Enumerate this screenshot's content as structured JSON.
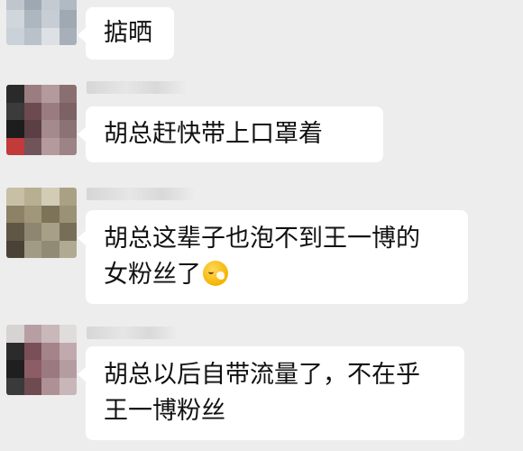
{
  "messages": [
    {
      "sender": "",
      "text_lines": [
        "掂晒"
      ],
      "emoji": false
    },
    {
      "sender": "",
      "text_lines": [
        "胡总赶快带上口罩着"
      ],
      "emoji": false
    },
    {
      "sender": "",
      "text_lines": [
        "胡总这辈子也泡不到王一博的",
        "女粉丝了"
      ],
      "emoji": "face-with-hand-over-mouth-emoji"
    },
    {
      "sender": "",
      "text_lines": [
        "胡总以后自带流量了，不在乎",
        "王一博粉丝"
      ],
      "emoji": false
    }
  ],
  "colors": {
    "background": "#ededed",
    "bubble": "#ffffff",
    "text": "#111111"
  }
}
